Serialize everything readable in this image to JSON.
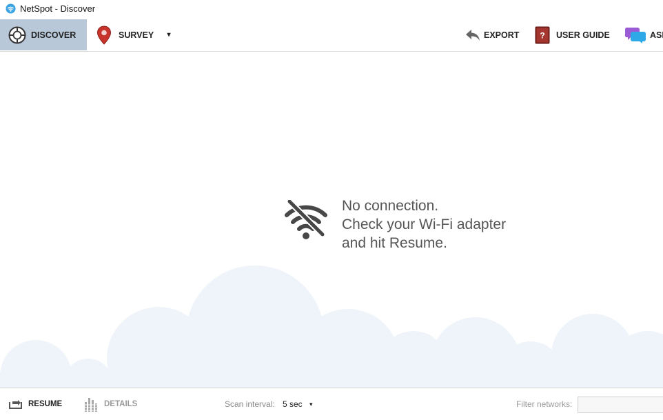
{
  "window": {
    "title": "NetSpot - Discover",
    "app_icon": "netspot-logo-icon"
  },
  "toolbar": {
    "discover": {
      "label": "DISCOVER",
      "icon": "crosshair-icon",
      "active": true
    },
    "survey": {
      "label": "SURVEY",
      "icon": "map-pin-icon"
    },
    "survey_dropdown": {
      "icon": "caret-down-icon",
      "glyph": "▾"
    },
    "export": {
      "label": "EXPORT",
      "icon": "reply-arrow-icon"
    },
    "user_guide": {
      "label": "USER GUIDE",
      "icon": "help-book-icon"
    },
    "ask": {
      "label": "ASK",
      "icon": "chat-bubbles-icon"
    }
  },
  "main": {
    "message_lines": [
      "No connection.",
      "Check your Wi-Fi adapter",
      "and hit Resume."
    ],
    "icon": "wifi-off-icon"
  },
  "statusbar": {
    "resume": {
      "label": "RESUME",
      "icon": "resume-icon"
    },
    "details": {
      "label": "DETAILS",
      "icon": "bars-icon",
      "enabled": false
    },
    "scan_interval": {
      "label": "Scan interval:",
      "value": "5 sec",
      "caret": "▾"
    },
    "filter": {
      "label": "Filter networks:",
      "value": "",
      "placeholder": ""
    }
  },
  "colors": {
    "active_tab": "#b8c8d9",
    "cloud": "#eef4fa",
    "message_text": "#555555",
    "pin_red": "#c8342b",
    "book_red": "#8b2a25",
    "chat_purple": "#9b5bd6",
    "chat_blue": "#2ea8e6"
  }
}
